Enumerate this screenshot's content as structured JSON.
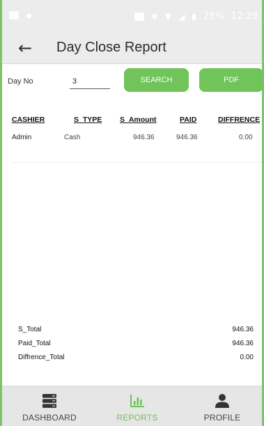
{
  "status_bar": {
    "time": "12:29",
    "battery": "25%"
  },
  "app_bar": {
    "title": "Day Close Report"
  },
  "search": {
    "day_label": "Day No",
    "day_value": "3",
    "search_label": "SEARCH",
    "pdf_label": "PDF"
  },
  "table": {
    "headers": [
      "CASHIER",
      "S_TYPE",
      "S_Amount",
      "PAID",
      "DIFFRENCE"
    ],
    "rows": [
      [
        "Admin",
        "Cash",
        "946.36",
        "946.36",
        "0.00"
      ]
    ]
  },
  "totals": {
    "s_total_label": "S_Total",
    "s_total_value": "946.36",
    "paid_total_label": "Paid_Total",
    "paid_total_value": "946.36",
    "diff_total_label": "Diffrence_Total",
    "diff_total_value": "0.00"
  },
  "bottom_nav": {
    "dashboard": "DASHBOARD",
    "reports": "REPORTS",
    "profile": "PROFILE"
  },
  "icons": {
    "back": "back-arrow-icon",
    "dashboard": "server-stack-icon",
    "reports": "bar-chart-icon",
    "profile": "person-icon"
  },
  "colors": {
    "accent": "#70c45a",
    "frame": "#7cc36a",
    "appbar_bg": "#ececec"
  }
}
